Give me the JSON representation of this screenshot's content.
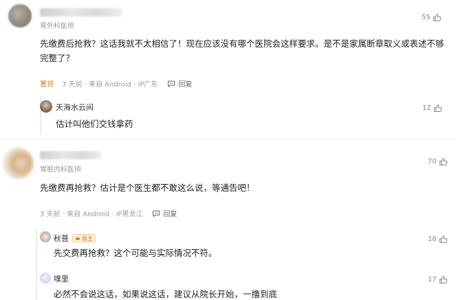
{
  "comments": [
    {
      "user_title": "肾外科医师",
      "text": "先缴费后抢救？这话我就不太相信了！现在应该没有哪个医院会这样要求。是不是家属断章取义或表述不够完整了？",
      "pin_label": "置顶",
      "meta": "3 天前 · 来自 Android · IP广东",
      "reply_label": "回复",
      "likes": "55",
      "replies": [
        {
          "username": "天海水云间",
          "text": "估计叫他们交钱拿药",
          "likes": "12"
        }
      ]
    },
    {
      "user_title": "胃脏内科医师",
      "text": "先缴费再抢救？估计是个医生都不敢这么说，等通告吧！",
      "meta": "3 天前 · 来自 Android · IP黑龙江",
      "reply_label": "回复",
      "likes": "70",
      "replies": [
        {
          "username": "秋菩",
          "badge": "版主",
          "text": "先交费再抢救？这个可能与实际情况不符。",
          "likes": "16"
        },
        {
          "username": "噗里",
          "text": "必然不会说这话，如果说这话，建议从院长开始，一撸到底",
          "likes": "17"
        }
      ]
    }
  ],
  "icons": {
    "like": "thumbs-up-icon",
    "reply": "comment-bubble-icon",
    "badge": "crown-icon"
  },
  "colors": {
    "pin": "#e0791f",
    "badge_text": "#c77a16",
    "badge_bg": "#fff4e0"
  }
}
